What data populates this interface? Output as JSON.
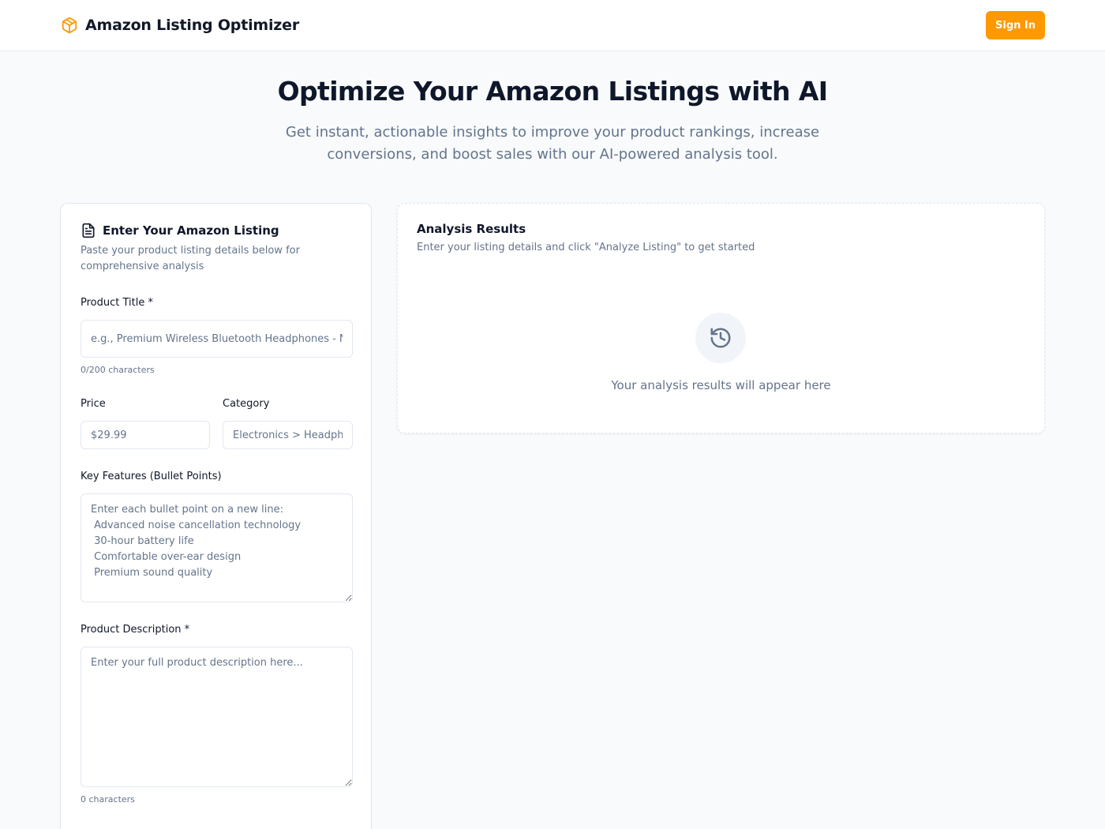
{
  "header": {
    "app_name": "Amazon Listing Optimizer",
    "logo_icon": "package-box-icon",
    "sign_in_label": "Sign In"
  },
  "hero": {
    "title": "Optimize Your Amazon Listings with AI",
    "subtitle": "Get instant, actionable insights to improve your product rankings, increase conversions, and boost sales with our AI-powered analysis tool."
  },
  "form": {
    "icon": "document-icon",
    "title": "Enter Your Amazon Listing",
    "description": "Paste your product listing details below for comprehensive analysis",
    "product_title": {
      "label": "Product Title *",
      "value": "",
      "placeholder": "e.g., Premium Wireless Bluetooth Headphones - Noise Cancelling",
      "counter": "0/200 characters"
    },
    "price": {
      "label": "Price",
      "value": "",
      "placeholder": "$29.99"
    },
    "category": {
      "label": "Category",
      "value": "",
      "placeholder": "Electronics > Headphones"
    },
    "features": {
      "label": "Key Features (Bullet Points)",
      "value": "",
      "placeholder": "Enter each bullet point on a new line:\n Advanced noise cancellation technology\n 30-hour battery life\n Comfortable over-ear design\n Premium sound quality"
    },
    "description_field": {
      "label": "Product Description *",
      "value": "",
      "placeholder": "Enter your full product description here...",
      "counter": "0 characters"
    }
  },
  "results": {
    "title": "Analysis Results",
    "description": "Enter your listing details and click \"Analyze Listing\" to get started",
    "empty_icon": "history-icon",
    "empty_text": "Your analysis results will appear here"
  },
  "colors": {
    "accent": "#ff9900",
    "page_bg": "#f8fafc",
    "muted_text": "#64748b",
    "border": "#e2e8f0"
  }
}
